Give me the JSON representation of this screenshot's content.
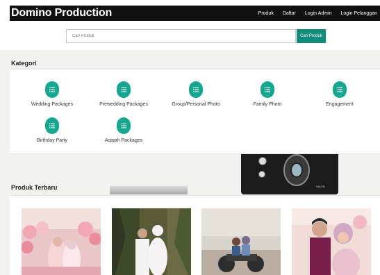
{
  "navbar": {
    "brand": "Domino Production",
    "links": [
      "Produk",
      "Daftar",
      "Login Admin",
      "Login Pelanggan"
    ]
  },
  "search": {
    "placeholder": "Cari Produk",
    "button_label": "Cari Produk"
  },
  "kategori": {
    "heading": "Kategori",
    "items": [
      "Wedding Packages",
      "Prewedding Packages",
      "Group/Personal Photo",
      "Family Photo",
      "Engagement",
      "Birthday Party",
      "Aqiqah Packages"
    ]
  },
  "produk": {
    "heading": "Produk Terbaru"
  },
  "decor": {
    "camera_label": "NIKON"
  },
  "colors": {
    "navbar_bg": "#111111",
    "accent": "#17a68f",
    "button": "#138a7a"
  }
}
